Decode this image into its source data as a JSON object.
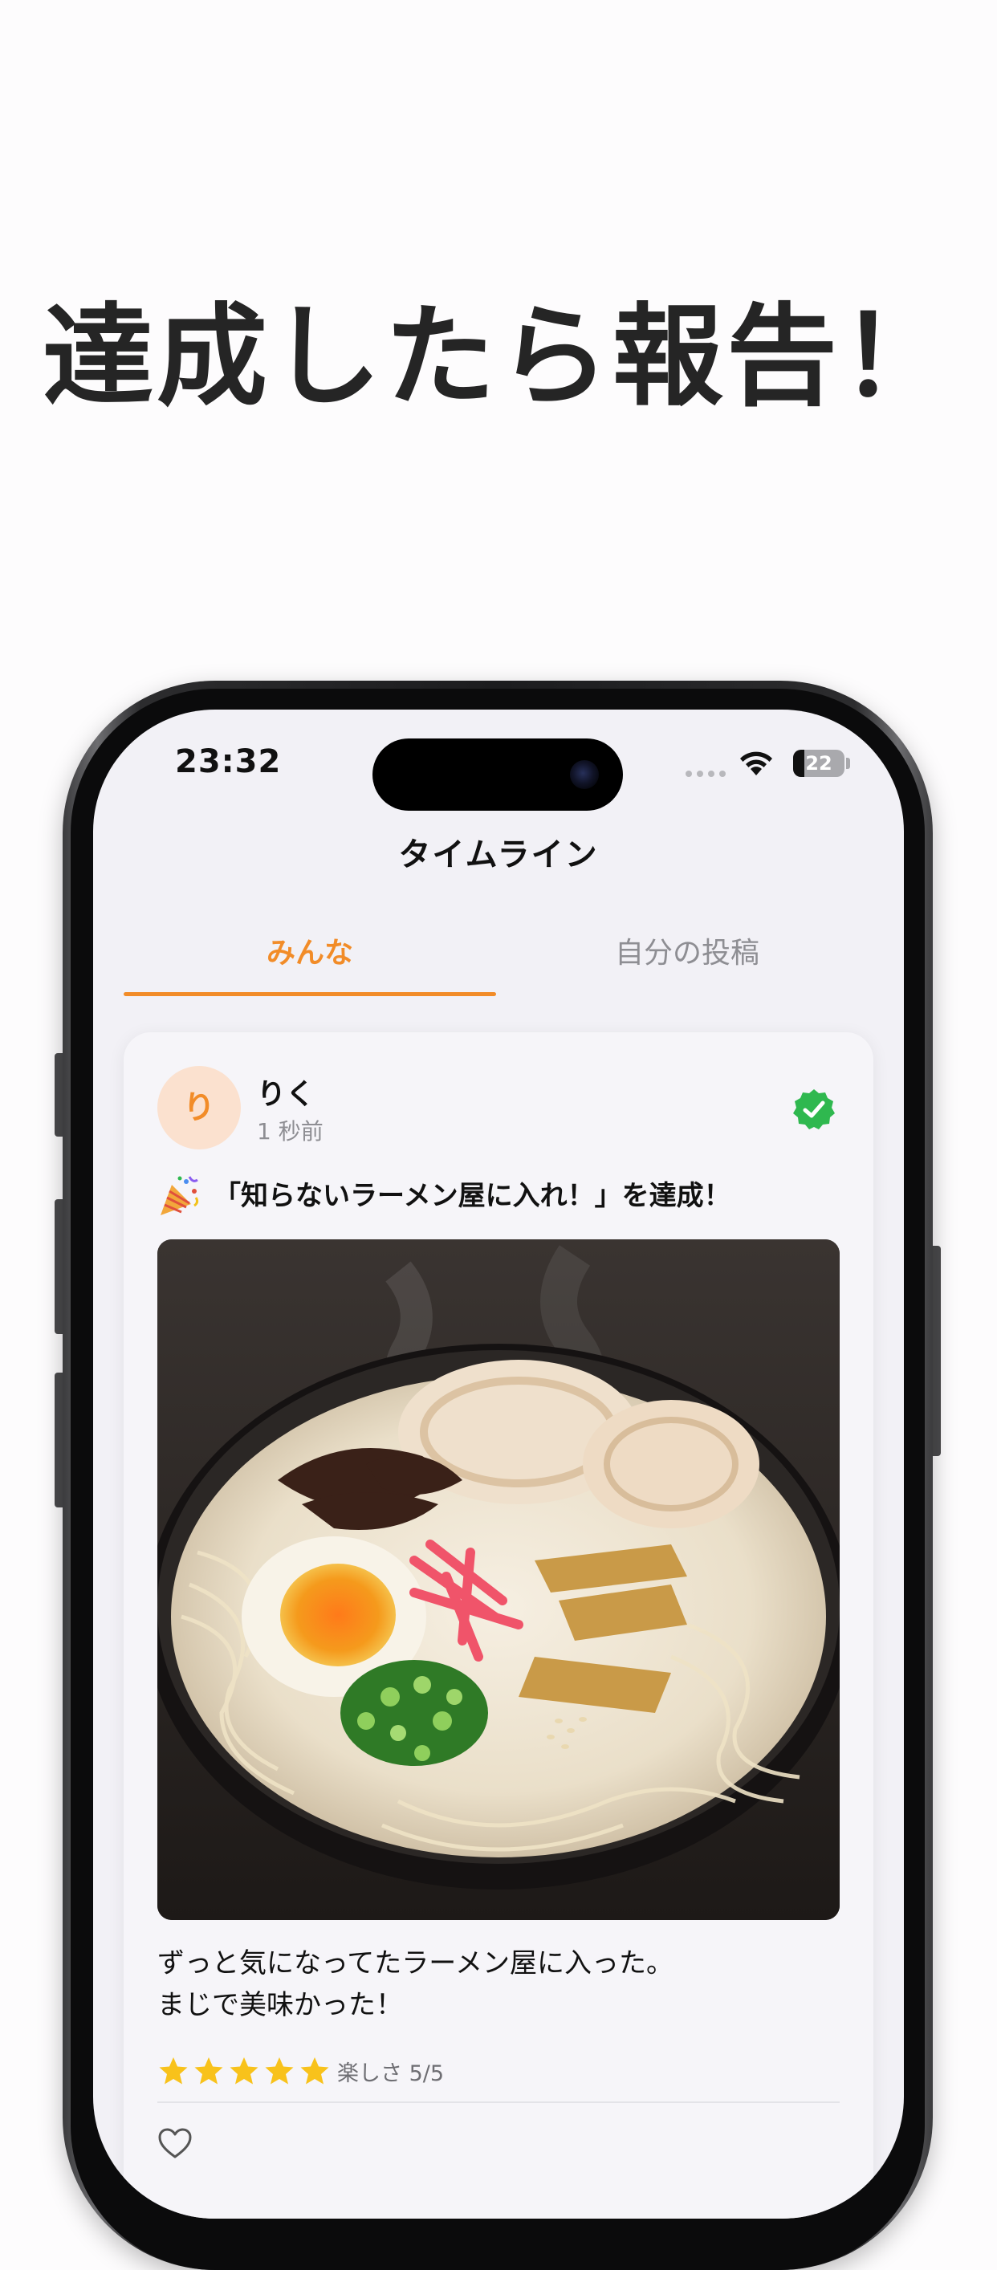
{
  "headline": "達成したら報告！",
  "status_bar": {
    "time": "23:32",
    "battery_level": "22",
    "battery_percent": 22
  },
  "nav": {
    "title": "タイムライン"
  },
  "tabs": [
    {
      "label": "みんな",
      "active": true
    },
    {
      "label": "自分の投稿",
      "active": false
    }
  ],
  "post": {
    "avatar_initial": "り",
    "user_name": "りく",
    "time_ago": "1 秒前",
    "verified": true,
    "achievement_text": "「知らないラーメン屋に入れ！」を達成！",
    "body_text": "ずっと気になってたラーメン屋に入った。\nまじで美味かった！",
    "rating": {
      "stars": 5,
      "max": 5,
      "label": "楽しさ 5/5"
    }
  },
  "colors": {
    "accent": "#f28c28",
    "verified_green": "#2fb84f",
    "star_yellow": "#f8c21b",
    "tab_inactive": "#8e8e93",
    "screen_background": "#f2f1f6"
  },
  "icons": {
    "wifi": "wifi-icon",
    "battery": "battery-icon",
    "verified": "verified-badge-icon",
    "party": "party-popper-icon",
    "star": "star-icon",
    "like": "heart-outline-icon"
  }
}
